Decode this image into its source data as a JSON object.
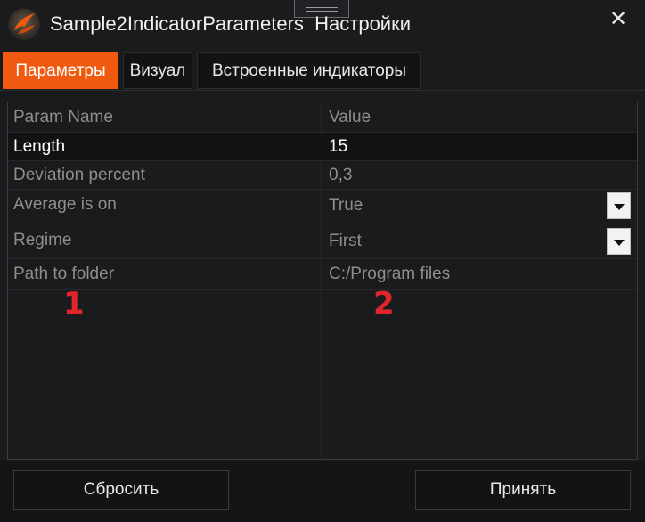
{
  "window": {
    "title": "Sample2IndicatorParameters  Настройки",
    "close_glyph": "✕"
  },
  "tabs": [
    {
      "label": "Параметры",
      "active": true
    },
    {
      "label": "Визуал",
      "active": false
    },
    {
      "label": "Встроенные индикаторы",
      "active": false
    }
  ],
  "grid": {
    "headers": {
      "name": "Param Name",
      "value": "Value"
    },
    "rows": [
      {
        "name": "Length",
        "value": "15",
        "selected": true,
        "dropdown": false
      },
      {
        "name": "Deviation percent",
        "value": "0,3",
        "selected": false,
        "dropdown": false
      },
      {
        "name": "Average is on",
        "value": "True",
        "selected": false,
        "dropdown": true
      },
      {
        "name": "Regime",
        "value": "First",
        "selected": false,
        "dropdown": true
      },
      {
        "name": "Path to folder",
        "value": "C:/Program files",
        "selected": false,
        "dropdown": false
      }
    ]
  },
  "annotations": {
    "marker_1": "1",
    "marker_2": "2"
  },
  "footer": {
    "reset_label": "Сбросить",
    "accept_label": "Принять"
  },
  "colors": {
    "accent": "#f05a10",
    "marker": "#e0252b",
    "background": "#1a1b1d"
  },
  "icons": {
    "logo": "app-logo-icon",
    "close": "close-icon",
    "dropdown": "chevron-down-icon"
  }
}
